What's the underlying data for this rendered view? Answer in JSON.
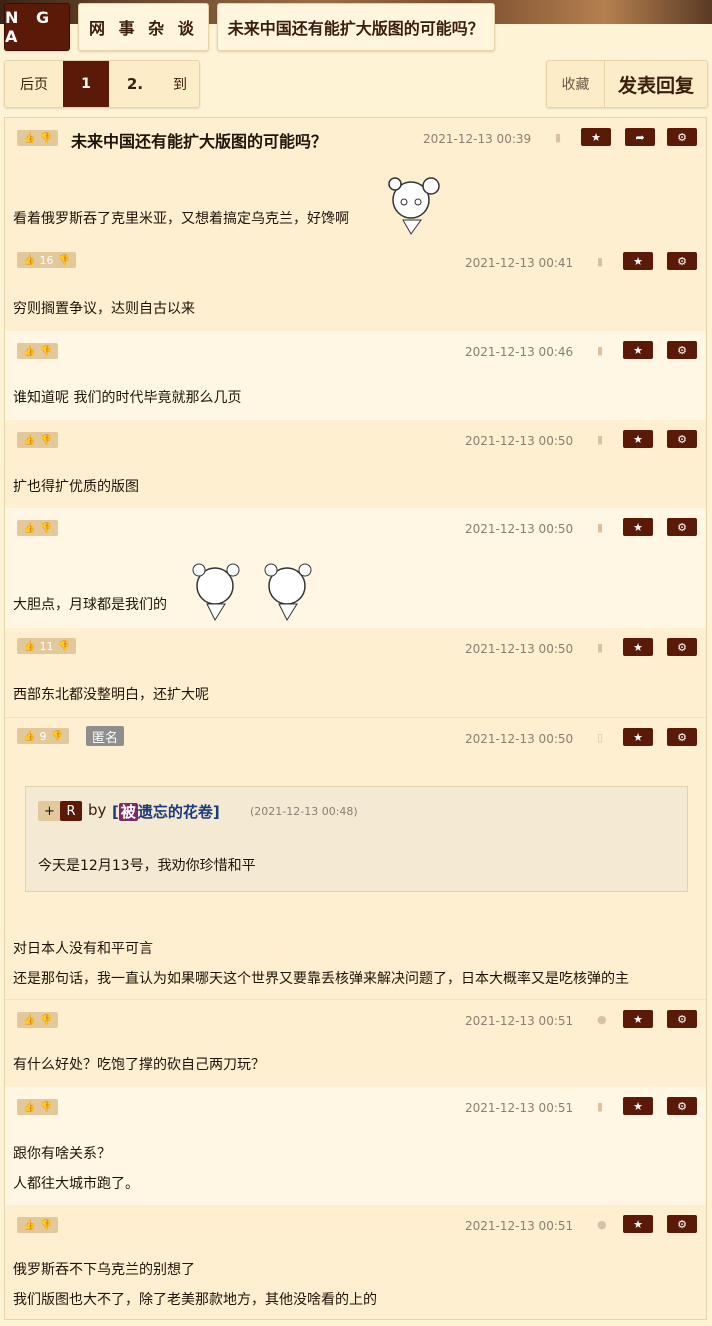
{
  "header": {
    "logo": "N G A",
    "section": "网 事 杂 谈",
    "thread_title": "未来中国还有能扩大版图的可能吗？"
  },
  "pager": {
    "prev": "后页",
    "page1": "1",
    "page2": "2.",
    "goto": "到"
  },
  "actions": {
    "favorite": "收藏",
    "reply": "发表回复"
  },
  "posts": [
    {
      "title": "未来中国还有能扩大版图的可能吗？",
      "date": "2021-12-13 00:39",
      "likes": "",
      "lines": [
        "看着俄罗斯吞了克里米亚，又想着搞定乌克兰，好馋啊"
      ]
    },
    {
      "date": "2021-12-13 00:41",
      "likes": "16",
      "lines": [
        "穷则搁置争议，达则自古以来"
      ]
    },
    {
      "date": "2021-12-13 00:46",
      "likes": "",
      "lines": [
        "谁知道呢 我们的时代毕竟就那么几页"
      ]
    },
    {
      "date": "2021-12-13 00:50",
      "likes": "",
      "lines": [
        "扩也得扩优质的版图"
      ]
    },
    {
      "date": "2021-12-13 00:50",
      "likes": "",
      "lines": [
        "大胆点，月球都是我们的"
      ]
    },
    {
      "date": "2021-12-13 00:50",
      "likes": "11",
      "lines": [
        "西部东北都没整明白，还扩大呢"
      ]
    },
    {
      "date": "2021-12-13 00:50",
      "likes": "9",
      "anon": "匿名",
      "quote": {
        "plus": "+",
        "r": "R",
        "by": "by",
        "user_tag": "被",
        "user_rest": "遗忘的花卷",
        "date": "(2021-12-13 00:48)",
        "text": "今天是12月13号，我劝你珍惜和平"
      },
      "lines": [
        "对日本人没有和平可言",
        "还是那句话，我一直认为如果哪天这个世界又要靠丢核弹来解决问题了，日本大概率又是吃核弹的主"
      ]
    },
    {
      "date": "2021-12-13 00:51",
      "likes": "",
      "lines": [
        "有什么好处？吃饱了撑的砍自己两刀玩？"
      ]
    },
    {
      "date": "2021-12-13 00:51",
      "likes": "",
      "lines": [
        "跟你有啥关系？",
        "人都往大城市跑了。"
      ]
    },
    {
      "date": "2021-12-13 00:51",
      "likes": "",
      "lines": [
        "俄罗斯吞不下乌克兰的别想了",
        "我们版图也大不了，除了老美那款地方，其他没啥看的上的"
      ]
    }
  ],
  "icons": {
    "thumb_up": "👍",
    "thumb_down": "👎",
    "star": "★",
    "share": "➦",
    "gear": "⚙",
    "android": "🤖",
    "apple": "",
    "phone": "▯"
  },
  "colors": {
    "accent": "#5b1a08",
    "background": "#fef3d5",
    "vote_bg": "#e3c89c"
  }
}
